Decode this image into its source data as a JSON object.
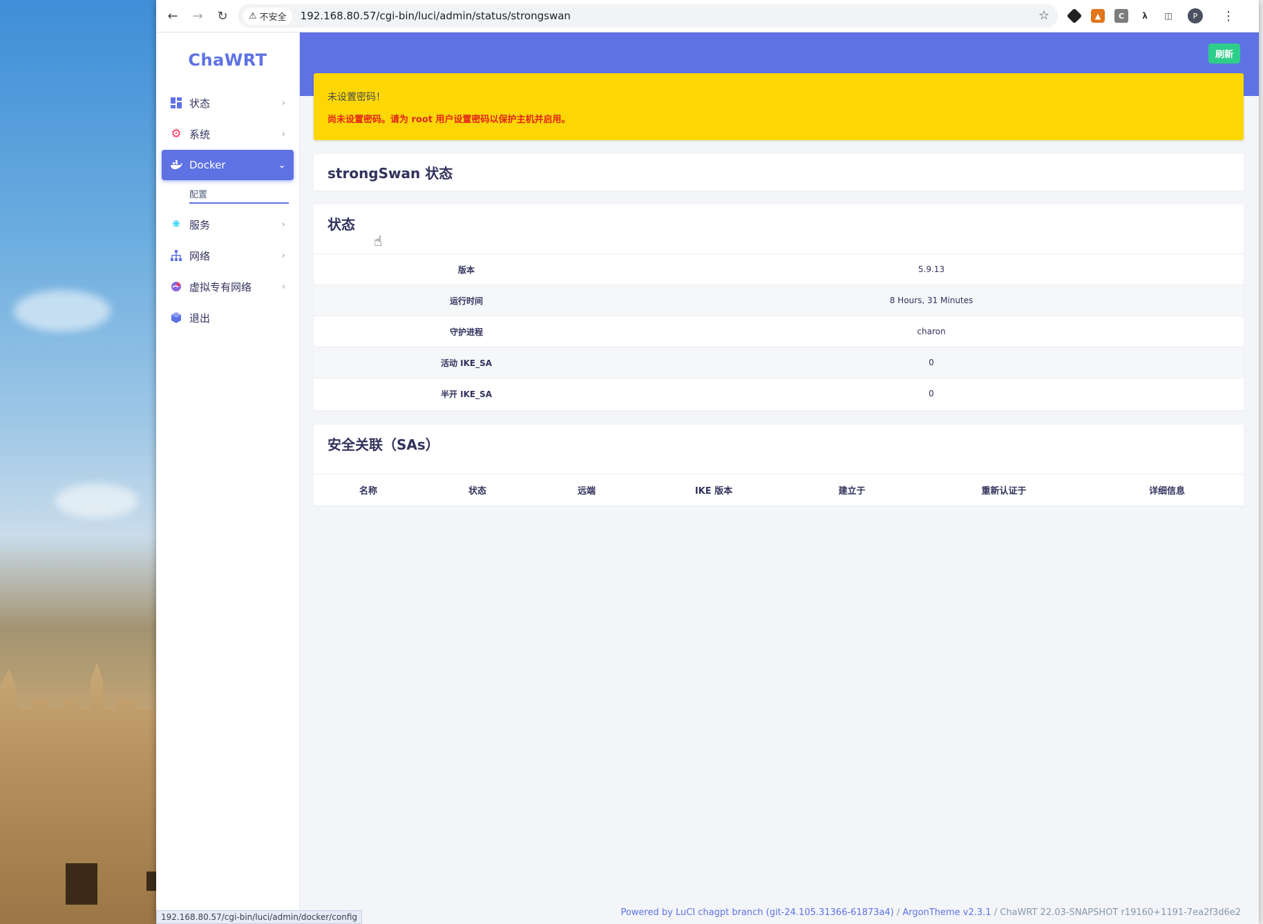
{
  "browser": {
    "security_label": "不安全",
    "url": "192.168.80.57/cgi-bin/luci/admin/status/strongswan",
    "profile_initial": "P",
    "status_bar_url": "192.168.80.57/cgi-bin/luci/admin/docker/config"
  },
  "sidebar": {
    "logo": "ChaWRT",
    "items": [
      {
        "label": "状态",
        "icon": "dashboard-icon"
      },
      {
        "label": "系统",
        "icon": "gear-icon"
      },
      {
        "label": "Docker",
        "icon": "docker-icon"
      },
      {
        "label": "服务",
        "icon": "cogs-icon"
      },
      {
        "label": "网络",
        "icon": "network-icon"
      },
      {
        "label": "虚拟专有网络",
        "icon": "vpn-icon"
      },
      {
        "label": "退出",
        "icon": "logout-icon"
      }
    ],
    "docker_submenu": [
      "配置"
    ]
  },
  "header": {
    "refresh_label": "刷新"
  },
  "warning": {
    "title": "未设置密码！",
    "message": "尚未设置密码。请为 root 用户设置密码以保护主机并启用。"
  },
  "page_title": "strongSwan 状态",
  "status_section": {
    "title": "状态",
    "rows": [
      {
        "key": "版本",
        "value": "5.9.13"
      },
      {
        "key": "运行时间",
        "value": "8 Hours, 31 Minutes"
      },
      {
        "key": "守护进程",
        "value": "charon"
      },
      {
        "key": "活动 IKE_SA",
        "value": "0"
      },
      {
        "key": "半开 IKE_SA",
        "value": "0"
      }
    ]
  },
  "sa_section": {
    "title": "安全关联（SAs）",
    "columns": [
      "名称",
      "状态",
      "远端",
      "IKE 版本",
      "建立于",
      "重新认证于",
      "详细信息"
    ]
  },
  "footer": {
    "luci": "Powered by LuCI chagpt branch (git-24.105.31366-61873a4)",
    "sep1": " / ",
    "theme": "ArgonTheme v2.3.1",
    "sep2": " / ",
    "build": "ChaWRT 22.03-SNAPSHOT r19160+1191-7ea2f3d6e2"
  },
  "colors": {
    "accent": "#5e72e4",
    "warning_bg": "#fcd705",
    "warning_text": "#e2231a",
    "refresh_bg": "#2dce89"
  }
}
